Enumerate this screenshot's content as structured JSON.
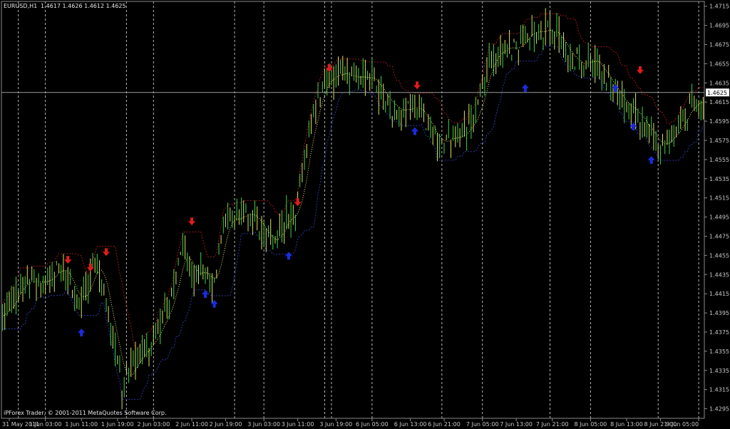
{
  "header": {
    "symbol": "EURUSD,H1",
    "ohlc": "1.4617 1.4626 1.4612 1.4625"
  },
  "footer": {
    "copyright": "iPForex Trader, © 2001-2011 MetaQuotes Software Corp."
  },
  "colors": {
    "background": "#000000",
    "frame": "#8a8a8a",
    "grid": "#d8d8d8",
    "candle": "#3cd24a",
    "candle_alt": "#d8e060",
    "upper_band": "#a01818",
    "lower_band": "#2a3aa8",
    "mid_line": "#e8e860",
    "arrow_down": "#e01c1c",
    "arrow_up": "#1a2ce0",
    "bid_line": "#9a9a9a",
    "bid_box": "#ffffff"
  },
  "chart_data": {
    "type": "candlestick",
    "symbol": "EURUSD",
    "timeframe": "H1",
    "ylim": [
      1.4285,
      1.472
    ],
    "y_ticks": [
      "1.4715",
      "1.4695",
      "1.4675",
      "1.4655",
      "1.4635",
      "1.4615",
      "1.4595",
      "1.4575",
      "1.4555",
      "1.4535",
      "1.4515",
      "1.4495",
      "1.4475",
      "1.4455",
      "1.4435",
      "1.4415",
      "1.4395",
      "1.4375",
      "1.4355",
      "1.4335",
      "1.4315",
      "1.4295"
    ],
    "current_price": "1.4625",
    "x_tick_labels": [
      "31 May 2011",
      "1 Jun 03:00",
      "1 Jun 11:00",
      "1 Jun 19:00",
      "2 Jun 03:00",
      "2 Jun 11:00",
      "2 Jun 19:00",
      "3 Jun 03:00",
      "3 Jun 11:00",
      "3 Jun 19:00",
      "6 Jun 05:00",
      "6 Jun 13:00",
      "6 Jun 21:00",
      "7 Jun 05:00",
      "7 Jun 13:00",
      "7 Jun 21:00",
      "8 Jun 05:00",
      "8 Jun 13:00",
      "8 Jun 21:00",
      "9 Jun 05:00"
    ],
    "x_tick_index": [
      3,
      19,
      35,
      51,
      67,
      84,
      99,
      116,
      131,
      148,
      164,
      181,
      196,
      213,
      228,
      244,
      261,
      277,
      292,
      309
    ],
    "day_separators_index": [
      7,
      55,
      103,
      143,
      146,
      195,
      243,
      291
    ],
    "bars": 312,
    "anchors": [
      [
        0,
        1.439
      ],
      [
        8,
        1.4425
      ],
      [
        20,
        1.443
      ],
      [
        26,
        1.4445
      ],
      [
        34,
        1.4405
      ],
      [
        38,
        1.4425
      ],
      [
        42,
        1.445
      ],
      [
        47,
        1.439
      ],
      [
        53,
        1.432
      ],
      [
        56,
        1.4335
      ],
      [
        66,
        1.4365
      ],
      [
        74,
        1.4405
      ],
      [
        80,
        1.447
      ],
      [
        84,
        1.443
      ],
      [
        88,
        1.4445
      ],
      [
        93,
        1.442
      ],
      [
        98,
        1.449
      ],
      [
        104,
        1.4495
      ],
      [
        110,
        1.45
      ],
      [
        116,
        1.448
      ],
      [
        120,
        1.4465
      ],
      [
        126,
        1.4495
      ],
      [
        130,
        1.45
      ],
      [
        137,
        1.4595
      ],
      [
        143,
        1.464
      ],
      [
        150,
        1.4645
      ],
      [
        158,
        1.464
      ],
      [
        164,
        1.464
      ],
      [
        170,
        1.4615
      ],
      [
        176,
        1.4605
      ],
      [
        182,
        1.461
      ],
      [
        188,
        1.4595
      ],
      [
        193,
        1.457
      ],
      [
        197,
        1.4575
      ],
      [
        203,
        1.458
      ],
      [
        210,
        1.46
      ],
      [
        216,
        1.466
      ],
      [
        222,
        1.467
      ],
      [
        228,
        1.467
      ],
      [
        234,
        1.469
      ],
      [
        240,
        1.469
      ],
      [
        246,
        1.4685
      ],
      [
        252,
        1.466
      ],
      [
        256,
        1.4655
      ],
      [
        262,
        1.466
      ],
      [
        268,
        1.464
      ],
      [
        274,
        1.4615
      ],
      [
        280,
        1.4605
      ],
      [
        286,
        1.4585
      ],
      [
        292,
        1.457
      ],
      [
        298,
        1.458
      ],
      [
        304,
        1.461
      ],
      [
        311,
        1.462
      ]
    ],
    "arrows_down": [
      [
        29,
        1.445
      ],
      [
        39,
        1.4442
      ],
      [
        46,
        1.4458
      ],
      [
        84,
        1.449
      ],
      [
        131,
        1.451
      ],
      [
        145,
        1.465
      ],
      [
        184,
        1.4632
      ],
      [
        283,
        1.4648
      ]
    ],
    "arrows_up": [
      [
        35,
        1.4375
      ],
      [
        90,
        1.4415
      ],
      [
        94,
        1.4405
      ],
      [
        127,
        1.4455
      ],
      [
        183,
        1.4585
      ],
      [
        232,
        1.463
      ],
      [
        272,
        1.463
      ],
      [
        280,
        1.459
      ],
      [
        288,
        1.4555
      ]
    ]
  }
}
